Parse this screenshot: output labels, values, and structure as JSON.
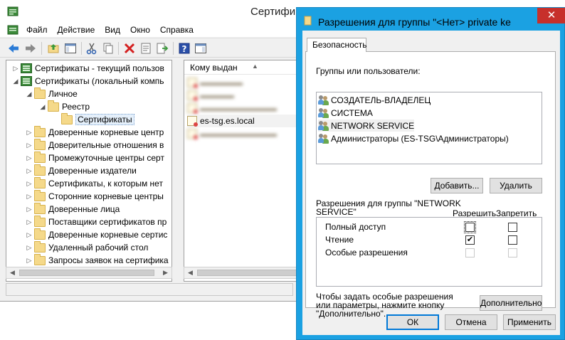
{
  "mmc": {
    "title": "Сертификаты",
    "menu": [
      "Файл",
      "Действие",
      "Вид",
      "Окно",
      "Справка"
    ],
    "tree": [
      {
        "label": "Сертификаты - текущий пользов",
        "indent": 0,
        "arrow": "▷",
        "icon": "cert-store-icon"
      },
      {
        "label": "Сертификаты (локальный компь",
        "indent": 0,
        "arrow": "◢",
        "icon": "cert-store-icon"
      },
      {
        "label": "Личное",
        "indent": 1,
        "arrow": "◢",
        "icon": "folder-icon"
      },
      {
        "label": "Реестр",
        "indent": 2,
        "arrow": "◢",
        "icon": "folder-icon"
      },
      {
        "label": "Сертификаты",
        "indent": 3,
        "arrow": "",
        "icon": "folder-open-icon",
        "selected": true
      },
      {
        "label": "Доверенные корневые центр",
        "indent": 1,
        "arrow": "▷",
        "icon": "folder-icon"
      },
      {
        "label": "Доверительные отношения в",
        "indent": 1,
        "arrow": "▷",
        "icon": "folder-icon"
      },
      {
        "label": "Промежуточные центры серт",
        "indent": 1,
        "arrow": "▷",
        "icon": "folder-icon"
      },
      {
        "label": "Доверенные издатели",
        "indent": 1,
        "arrow": "▷",
        "icon": "folder-icon"
      },
      {
        "label": "Сертификаты, к которым нет",
        "indent": 1,
        "arrow": "▷",
        "icon": "folder-icon"
      },
      {
        "label": "Сторонние корневые центры",
        "indent": 1,
        "arrow": "▷",
        "icon": "folder-icon"
      },
      {
        "label": "Доверенные лица",
        "indent": 1,
        "arrow": "▷",
        "icon": "folder-icon"
      },
      {
        "label": "Поставщики сертификатов пр",
        "indent": 1,
        "arrow": "▷",
        "icon": "folder-icon"
      },
      {
        "label": "Доверенные корневые сертис",
        "indent": 1,
        "arrow": "▷",
        "icon": "folder-icon"
      },
      {
        "label": "Удаленный рабочий стол",
        "indent": 1,
        "arrow": "▷",
        "icon": "folder-icon"
      },
      {
        "label": "Запросы заявок на сертифика",
        "indent": 1,
        "arrow": "▷",
        "icon": "folder-icon"
      }
    ],
    "list_header": "Кому выдан",
    "list_rows": [
      {
        "label": "",
        "blurred": true
      },
      {
        "label": "",
        "blurred": true
      },
      {
        "label": "",
        "blurred": true
      },
      {
        "label": "es-tsg.es.local",
        "blurred": false,
        "selected": true
      },
      {
        "label": "",
        "blurred": true
      }
    ]
  },
  "dialog": {
    "title": "Разрешения для группы \"<Нет> private ke",
    "close": "✕",
    "tab": "Безопасность",
    "groups_label": "Группы или пользователи:",
    "users": [
      {
        "label": "СОЗДАТЕЛЬ-ВЛАДЕЛЕЦ",
        "selected": false
      },
      {
        "label": "СИСТЕМА",
        "selected": false
      },
      {
        "label": "NETWORK SERVICE",
        "selected": true
      },
      {
        "label": "Администраторы (ES-TSG\\Администраторы)",
        "selected": false
      }
    ],
    "add_button": "Добавить...",
    "remove_button": "Удалить",
    "perm_label": "Разрешения для группы \"NETWORK SERVICE\"",
    "allow_label": "Разрешить",
    "deny_label": "Запретить",
    "permissions": [
      {
        "name": "Полный доступ",
        "allow": false,
        "deny": false,
        "enabled": true
      },
      {
        "name": "Чтение",
        "allow": true,
        "deny": false,
        "enabled": true
      },
      {
        "name": "Особые разрешения",
        "allow": false,
        "deny": false,
        "enabled": false
      }
    ],
    "advanced_hint": "Чтобы задать особые разрешения или параметры, нажмите кнопку \"Дополнительно\".",
    "advanced_button": "Дополнительно",
    "ok": "ОК",
    "cancel": "Отмена",
    "apply": "Применить"
  }
}
